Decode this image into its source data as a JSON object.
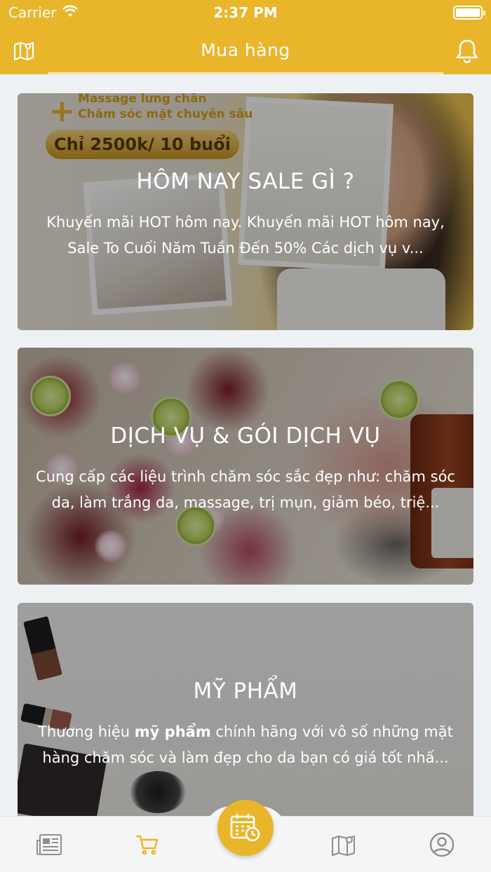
{
  "status_bar": {
    "carrier": "Carrier",
    "time": "2:37 PM"
  },
  "nav": {
    "title": "Mua hàng",
    "left_icon": "map-icon",
    "right_icon": "bell-icon"
  },
  "cards": [
    {
      "title": "HÔM NAY SALE GÌ ?",
      "description": "Khuyến mãi HOT hôm nay. Khuyến mãi HOT hôm nay, Sale To Cuối Năm Tuần Đến 50% Các dịch vụ v...",
      "promo_line1": "Massage lưng chân",
      "promo_line2": "Chăm sóc mặt chuyên sâu",
      "promo_price": "Chỉ 2500k/ 10 buổi"
    },
    {
      "title": "DỊCH VỤ & GÓI DỊCH VỤ",
      "description": "Cung cấp các liệu trình chăm sóc sắc đẹp như: chăm sóc da, làm trắng da, massage, trị mụn, giảm béo, triệ..."
    },
    {
      "title": "MỸ PHẨM",
      "description_prefix": "Thương hiệu ",
      "description_bold": "mỹ phẩm",
      "description_rest": " chính hãng với vô số những mặt hàng chăm sóc và làm đẹp cho da bạn có giá tốt nhấ..."
    }
  ],
  "tab_bar": {
    "items": [
      {
        "name": "news",
        "icon": "newspaper-icon",
        "active": false
      },
      {
        "name": "cart",
        "icon": "cart-icon",
        "active": true
      },
      {
        "name": "booking",
        "icon": "calendar-clock-icon",
        "active": false
      },
      {
        "name": "map",
        "icon": "map-pin-icon",
        "active": false
      },
      {
        "name": "profile",
        "icon": "user-circle-icon",
        "active": false
      }
    ]
  },
  "colors": {
    "brand": "#e9b52a",
    "tab_inactive": "#8e8e8e",
    "tab_active": "#e9b52a"
  }
}
